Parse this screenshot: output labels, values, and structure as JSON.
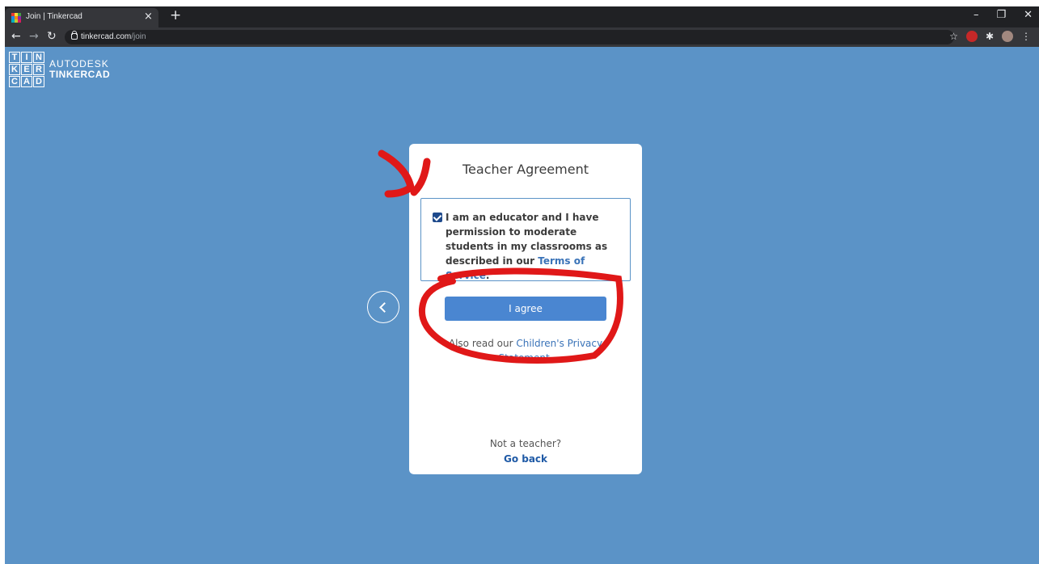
{
  "browser": {
    "tab_title": "Join | Tinkercad",
    "tab_close": "×",
    "new_tab": "+",
    "url_host": "tinkercad.com",
    "url_path": "/join",
    "window_controls": [
      "–",
      "❐",
      "✕"
    ]
  },
  "logo": {
    "letters": [
      "T",
      "I",
      "N",
      "K",
      "E",
      "R",
      "C",
      "A",
      "D"
    ],
    "line1": "AUTODESK",
    "line2": "TINKERCAD"
  },
  "card": {
    "title": "Teacher Agreement",
    "agreement_text": "I am an educator and I have permission to moderate students in my classrooms as described in our ",
    "tos_link": "Terms of Service",
    "tos_suffix": ".",
    "checkbox_checked": true,
    "agree_button": "I agree",
    "also_read": "Also read our ",
    "privacy_link_1": "Children's Privacy",
    "privacy_link_2": "Statement.",
    "not_teacher": "Not a teacher?",
    "go_back": "Go back"
  },
  "colors": {
    "page_bg": "#5b93c7",
    "button": "#4a86d1",
    "link": "#3a73b8",
    "annotation": "#e01818"
  },
  "icons": [
    "back-arrow-icon",
    "forward-arrow-icon",
    "reload-icon",
    "lock-icon",
    "star-icon",
    "extension-icon",
    "profile-avatar-icon",
    "menu-icon"
  ]
}
